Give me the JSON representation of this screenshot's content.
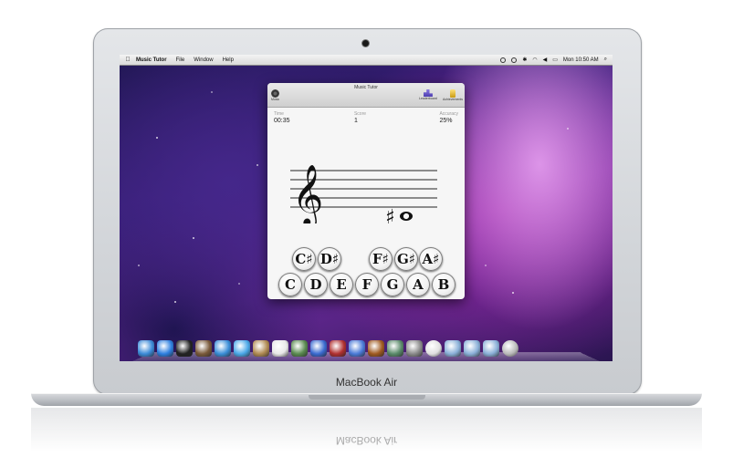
{
  "device": {
    "label": "MacBook Air",
    "reflection_label": "MacBook Air"
  },
  "menubar": {
    "apple_icon": "apple-icon",
    "app_name": "Music Tutor",
    "items": [
      "File",
      "Window",
      "Help"
    ],
    "clock": "Mon 10:50 AM"
  },
  "window": {
    "title": "Music Tutor",
    "toolbar": {
      "settings_label": "Music",
      "leaderboard_label": "Leaderboard",
      "achievements_label": "Achievements"
    },
    "stats": {
      "time_label": "Time",
      "time_value": "00:35",
      "score_label": "Score",
      "score_value": "1",
      "accuracy_label": "Accuracy",
      "accuracy_value": "25%"
    },
    "staff": {
      "clef": "𝄞",
      "note_accidental": "♯",
      "note_head": "𝅝"
    },
    "sharp_keys": [
      "C♯",
      "D♯",
      "F♯",
      "G♯",
      "A♯"
    ],
    "natural_keys": [
      "C",
      "D",
      "E",
      "F",
      "G",
      "A",
      "B"
    ]
  },
  "dock": {
    "icons": [
      "finder-icon",
      "app-store-icon",
      "dashboard-icon",
      "mail-icon",
      "safari-icon",
      "ichat-icon",
      "address-book-icon",
      "ical-icon",
      "preview-icon",
      "itunes-icon",
      "photo-booth-icon",
      "iphoto-icon",
      "garageband-icon",
      "time-machine-icon",
      "system-preferences-icon",
      "music-tutor-icon",
      "applications-folder-icon",
      "documents-folder-icon",
      "downloads-icon",
      "trash-icon"
    ],
    "colors": [
      "#3b8ad8",
      "#2d7fe0",
      "#222222",
      "#7a5a3a",
      "#3a8ed8",
      "#4aa8e8",
      "#b08a52",
      "#e8e8e8",
      "#5a8a50",
      "#3a6ad0",
      "#b03030",
      "#4a7ad8",
      "#a05a20",
      "#5a8a6a",
      "#8a8a8a",
      "#e0e0e0",
      "#8ab0d8",
      "#8ab0d8",
      "#8ab0d8",
      "#b8b8b8"
    ]
  }
}
